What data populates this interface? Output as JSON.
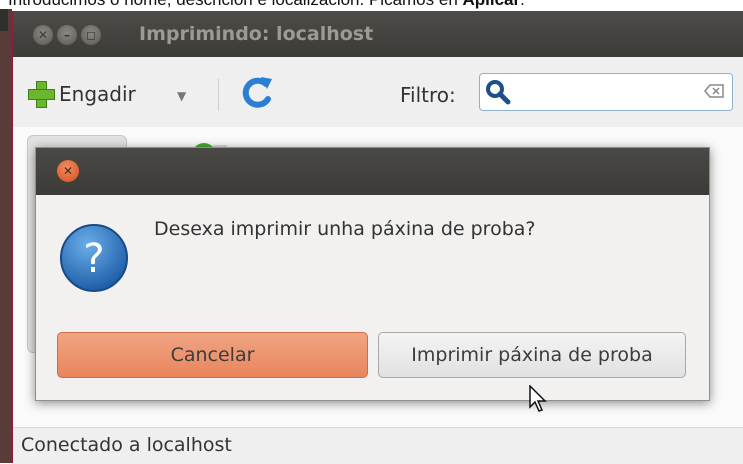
{
  "caption": {
    "text": "Introducimos o nome, descrición e localización. Picamos en ",
    "bold": "Aplicar",
    "end": "."
  },
  "window": {
    "title": "Imprimindo: localhost"
  },
  "toolbar": {
    "add_label": "Engadir",
    "filter_label": "Filtro:",
    "search_value": ""
  },
  "dialog": {
    "message": "Desexa imprimir unha páxina de proba?",
    "cancel_label": "Cancelar",
    "print_label": "Imprimir páxina de proba"
  },
  "status": {
    "text": "Conectado a localhost"
  },
  "colors": {
    "titlebar": "#3c3b37",
    "cancel_accent": "#e8855d",
    "close_button": "#d2501f",
    "question_icon": "#2a6fc0"
  }
}
